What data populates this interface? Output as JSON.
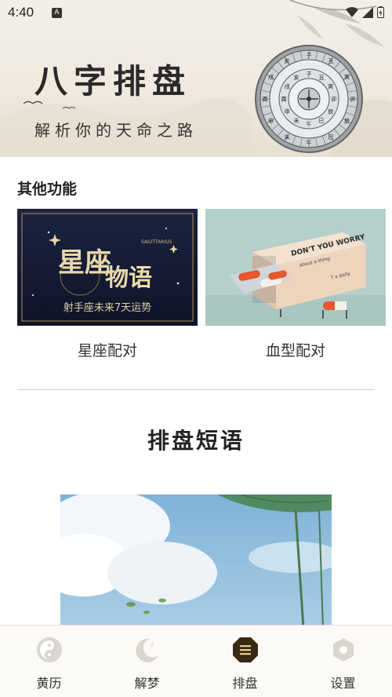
{
  "status_bar": {
    "time": "4:40",
    "notification_icon": "a-icon",
    "icons": [
      "wifi-icon",
      "signal-icon",
      "battery-icon"
    ]
  },
  "banner": {
    "title": "八字排盘",
    "subtitle": "解析你的天命之路",
    "compass_chars": [
      "子",
      "丑",
      "寅",
      "卯",
      "辰",
      "巳",
      "午",
      "未",
      "申",
      "酉",
      "戌",
      "亥"
    ]
  },
  "features": {
    "section_title": "其他功能",
    "items": [
      {
        "label": "星座配对",
        "image": {
          "title_line1": "星座",
          "title_line2": "物语",
          "tag": "SAGITTARIUS",
          "caption": "射手座未来7天运势"
        }
      },
      {
        "label": "血型配对",
        "image": {
          "box_text": "DON'T YOU WORRY",
          "box_sub": "about a thing",
          "side_text": "7 x daily"
        }
      }
    ]
  },
  "short_phrases": {
    "title": "排盘短语"
  },
  "bottom_nav": {
    "items": [
      {
        "label": "黄历",
        "icon": "yin-yang-icon",
        "active": false
      },
      {
        "label": "解梦",
        "icon": "moon-icon",
        "active": false
      },
      {
        "label": "排盘",
        "icon": "menu-icon",
        "active": true
      },
      {
        "label": "设置",
        "icon": "hexagon-icon",
        "active": false
      }
    ],
    "active_color": "#3a2a14",
    "inactive_color": "#d9d6d0"
  }
}
